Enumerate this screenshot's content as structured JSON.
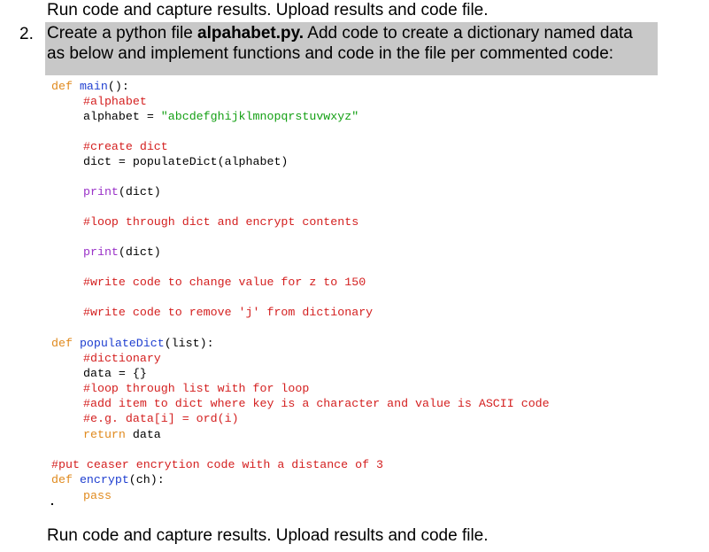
{
  "intro": {
    "top_line": "Run code and capture results. Upload results and code file.",
    "task_number": "2.",
    "task_line1_a": "Create a python file ",
    "task_line1_file": "alpahabet.py.",
    "task_line1_b": " Add code to create a dictionary named data",
    "task_line2": "as below and implement functions and code in the file per commented code:"
  },
  "code": {
    "l1_def": "def",
    "l1_name": "main",
    "l1_rest": "():",
    "l2": "#alphabet",
    "l3_a": "alphabet = ",
    "l3_str": "\"abcdefghijklmnopqrstuvwxyz\"",
    "l4": "#create dict",
    "l5": "dict = populateDict(alphabet)",
    "l6_fn": "print",
    "l6_rest": "(dict)",
    "l7": "#loop through dict and encrypt contents",
    "l8_fn": "print",
    "l8_rest": "(dict)",
    "l9": "#write code to change value for z to 150",
    "l10": "#write code to remove 'j' from dictionary",
    "l11_def": "def",
    "l11_name": "populateDict",
    "l11_rest": "(list):",
    "l12": "#dictionary",
    "l13": "data = {}",
    "l14": "#loop through list with for loop",
    "l15": "#add item to dict where key is a character and value is ASCII code",
    "l16": "#e.g. data[i] = ord(i)",
    "l17_kw": "return",
    "l17_rest": " data",
    "l18": "#put ceaser encrytion code with a distance of 3",
    "l19_def": "def",
    "l19_name": "encrypt",
    "l19_rest": "(ch):",
    "l20": "pass"
  },
  "outro": {
    "bottom_line": "Run code and capture results. Upload results and code file."
  }
}
